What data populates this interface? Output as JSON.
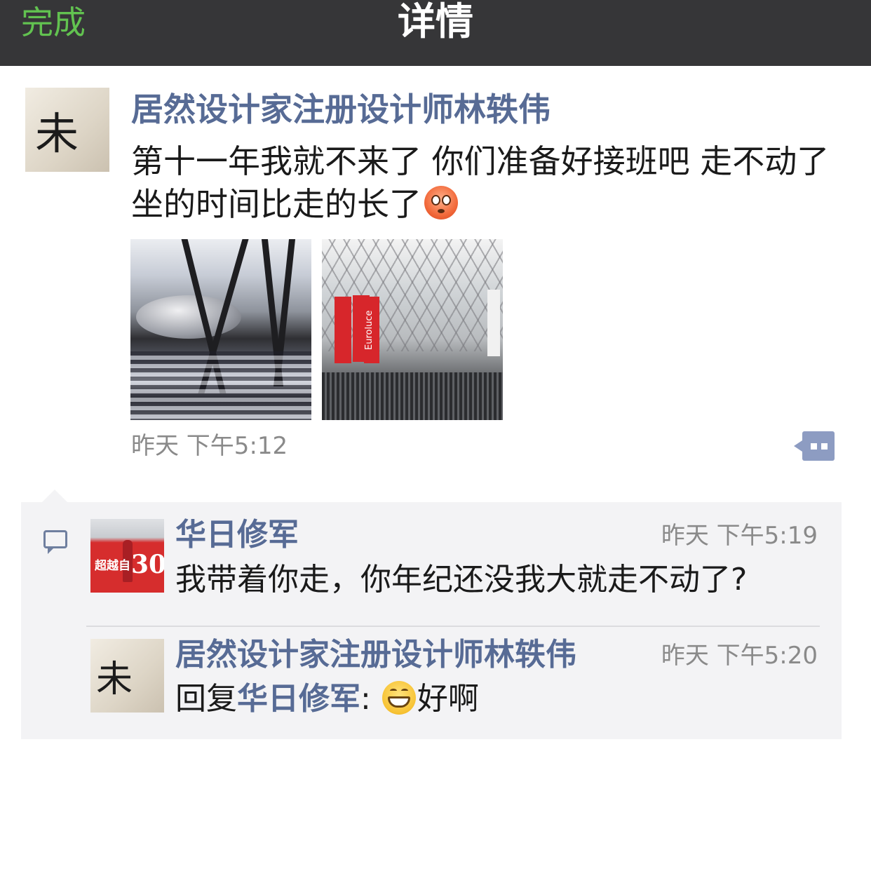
{
  "navbar": {
    "done_label": "完成",
    "title": "详情"
  },
  "post": {
    "author": "居然设计家注册设计师林轶伟",
    "text": "第十一年我就不来了 你们准备好接班吧 走不动了 坐的时间比走的长了",
    "emoji": "flushed-face-emoji",
    "photos": [
      {
        "name": "exhibition-hall-reflection-photo"
      },
      {
        "name": "euroluce-hall-photo",
        "banner_text": "Euroluce"
      }
    ],
    "time": "昨天 下午5:12",
    "more_icon": "comment-more-icon"
  },
  "comments": [
    {
      "author": "华日修军",
      "time": "昨天 下午5:19",
      "text": "我带着你走，你年纪还没我大就走不动了?",
      "avatar_text": "超越自",
      "avatar_number": "30"
    },
    {
      "author": "居然设计家注册设计师林轶伟",
      "time": "昨天 下午5:20",
      "reply_prefix": "回复",
      "reply_to": "华日修军",
      "reply_colon": ":",
      "emoji": "grinning-face-emoji",
      "text": "好啊"
    }
  ],
  "avatar_glyph": "未",
  "colors": {
    "navbar_bg": "#363638",
    "done_green": "#62c250",
    "link_blue": "#576b95",
    "comment_bg": "#f3f3f5"
  }
}
